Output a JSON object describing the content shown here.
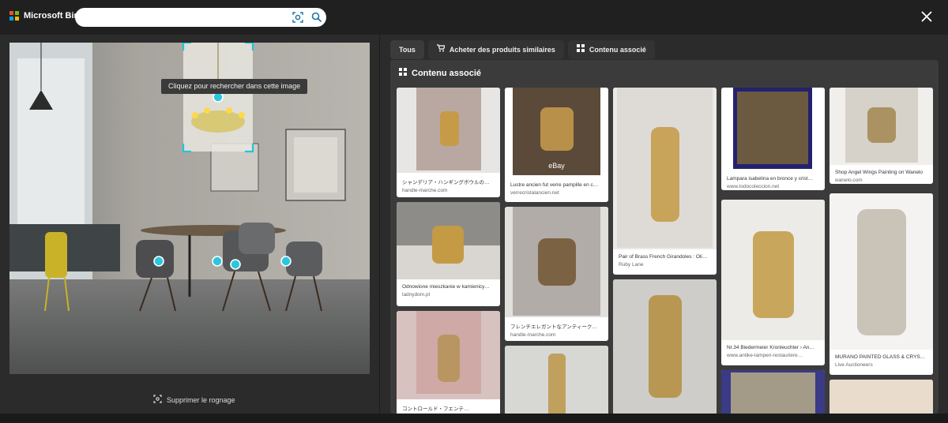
{
  "brand": {
    "name": "Microsoft Bing"
  },
  "search": {
    "value": "",
    "placeholder": ""
  },
  "left": {
    "crop_hint": "Cliquez pour rechercher dans cette image",
    "remove_crop": "Supprimer le rognage"
  },
  "tabs": [
    {
      "label": "Tous",
      "icon": "none"
    },
    {
      "label": "Acheter des produits similaires",
      "icon": "cart-icon"
    },
    {
      "label": "Contenu associé",
      "icon": "grid-icon"
    }
  ],
  "section": {
    "title": "Contenu associé"
  },
  "results": [
    {
      "title": "シャンデリア・ハンギングボウルの…",
      "source": "handle-marche.com"
    },
    {
      "title": "Lustre ancien fut verre pampille en c…",
      "source": "verrecristalancien.net",
      "watermark": "eBay"
    },
    {
      "title": "Pair of Brass French Girandoles : Oli…",
      "source": "Ruby Lane"
    },
    {
      "title": "Lampara isabelina en bronce y crist…",
      "source": "www.todocoleccion.net"
    },
    {
      "title": "Shop Angel Wings Painting on Wanelo",
      "source": "wanelo.com"
    },
    {
      "title": "Odnowione mieszkanie w kamienicy…",
      "source": "ladnydom.pl"
    },
    {
      "title": "フレンチエレガントなアンティーク…",
      "source": "handle-marche.com"
    },
    {
      "title": "Nr.34 Biedermeier Kronleuchter › An…",
      "source": "www.antike-lampen-restauriere…"
    },
    {
      "title": "MURANO PAINTED GLASS & CRYST…",
      "source": "Live Auctioneers"
    },
    {
      "title": "コントロールド・フエンテ…",
      "source": ""
    }
  ]
}
